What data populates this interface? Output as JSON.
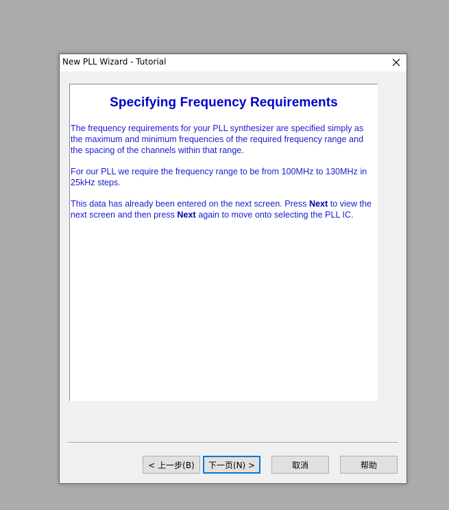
{
  "window": {
    "title": "New PLL Wizard - Tutorial"
  },
  "content": {
    "heading": "Specifying Frequency Requirements",
    "para1": "The frequency requirements for your PLL synthesizer are specified simply as the maximum and minimum frequencies of the required frequency range and the spacing of the channels within that range.",
    "para2": "For our PLL we require the frequency range to be from 100MHz to 130MHz in 25kHz steps.",
    "para3": {
      "part1": "This data has already been entered on the next screen.   Press ",
      "bold1": "Next",
      "part2": " to view the next screen and then press ",
      "bold2": "Next",
      "part3": " again to move onto selecting the PLL IC."
    }
  },
  "buttons": {
    "back": "< 上一步(B)",
    "next": "下一页(N) >",
    "cancel": "取消",
    "help": "帮助"
  },
  "icons": {
    "close": "close-icon"
  },
  "colors": {
    "text": "#0000cc",
    "desktop": "#ababab",
    "dialog": "#f0f0f0",
    "default_button_border": "#0078d7"
  }
}
